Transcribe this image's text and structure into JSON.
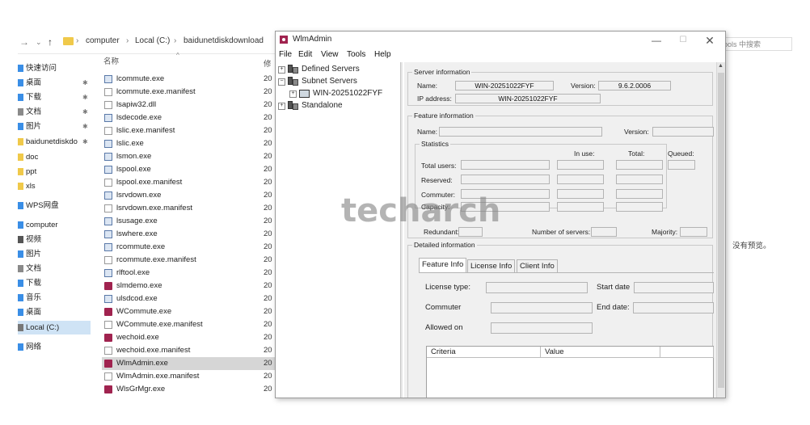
{
  "explorer": {
    "breadcrumb": [
      "computer",
      "Local (C:)",
      "baidunetdiskdownload"
    ],
    "search_placeholder": "ools 中搜索",
    "column_name": "名称",
    "column_date": "修",
    "sidebar": [
      {
        "label": "快速访问",
        "icon": "star-icon",
        "pinned": false
      },
      {
        "label": "桌面",
        "icon": "desktop-icon",
        "pinned": true
      },
      {
        "label": "下载",
        "icon": "download-icon",
        "pinned": true
      },
      {
        "label": "文档",
        "icon": "document-icon",
        "pinned": true
      },
      {
        "label": "图片",
        "icon": "picture-icon",
        "pinned": true
      },
      {
        "label": "baidunetdiskdo",
        "icon": "folder-icon",
        "pinned": true
      },
      {
        "label": "doc",
        "icon": "folder-icon",
        "pinned": false
      },
      {
        "label": "ppt",
        "icon": "folder-icon",
        "pinned": false
      },
      {
        "label": "xls",
        "icon": "folder-icon",
        "pinned": false
      },
      {
        "label": "WPS网盘",
        "icon": "cloud-icon",
        "pinned": false
      },
      {
        "label": "computer",
        "icon": "computer-icon",
        "pinned": false
      },
      {
        "label": "视频",
        "icon": "video-icon",
        "pinned": false
      },
      {
        "label": "图片",
        "icon": "picture-icon",
        "pinned": false
      },
      {
        "label": "文档",
        "icon": "document-icon",
        "pinned": false
      },
      {
        "label": "下载",
        "icon": "download-icon",
        "pinned": false
      },
      {
        "label": "音乐",
        "icon": "music-icon",
        "pinned": false
      },
      {
        "label": "桌面",
        "icon": "desktop-icon",
        "pinned": false
      },
      {
        "label": "Local (C:)",
        "icon": "drive-icon",
        "pinned": false
      },
      {
        "label": "网络",
        "icon": "network-icon",
        "pinned": false
      }
    ],
    "files": [
      {
        "name": "lcommute.exe",
        "type": "exe",
        "date": "20"
      },
      {
        "name": "lcommute.exe.manifest",
        "type": "doc",
        "date": "20"
      },
      {
        "name": "lsapiw32.dll",
        "type": "doc",
        "date": "20"
      },
      {
        "name": "lsdecode.exe",
        "type": "exe",
        "date": "20"
      },
      {
        "name": "lslic.exe.manifest",
        "type": "doc",
        "date": "20"
      },
      {
        "name": "lslic.exe",
        "type": "exe",
        "date": "20"
      },
      {
        "name": "lsmon.exe",
        "type": "exe",
        "date": "20"
      },
      {
        "name": "lspool.exe",
        "type": "exe",
        "date": "20"
      },
      {
        "name": "lspool.exe.manifest",
        "type": "doc",
        "date": "20"
      },
      {
        "name": "lsrvdown.exe",
        "type": "exe",
        "date": "20"
      },
      {
        "name": "lsrvdown.exe.manifest",
        "type": "doc",
        "date": "20"
      },
      {
        "name": "lsusage.exe",
        "type": "exe",
        "date": "20"
      },
      {
        "name": "lswhere.exe",
        "type": "exe",
        "date": "20"
      },
      {
        "name": "rcommute.exe",
        "type": "exe",
        "date": "20"
      },
      {
        "name": "rcommute.exe.manifest",
        "type": "doc",
        "date": "20"
      },
      {
        "name": "rlftool.exe",
        "type": "exe",
        "date": "20"
      },
      {
        "name": "slmdemo.exe",
        "type": "app",
        "date": "20"
      },
      {
        "name": "ulsdcod.exe",
        "type": "exe",
        "date": "20"
      },
      {
        "name": "WCommute.exe",
        "type": "app",
        "date": "20"
      },
      {
        "name": "WCommute.exe.manifest",
        "type": "doc",
        "date": "20"
      },
      {
        "name": "wechoid.exe",
        "type": "app",
        "date": "20"
      },
      {
        "name": "wechoid.exe.manifest",
        "type": "doc",
        "date": "20"
      },
      {
        "name": "WlmAdmin.exe",
        "type": "app",
        "date": "20",
        "selected": true
      },
      {
        "name": "WlmAdmin.exe.manifest",
        "type": "doc",
        "date": "20"
      },
      {
        "name": "WlsGrMgr.exe",
        "type": "app",
        "date": "20"
      }
    ],
    "preview_text": "没有预览。"
  },
  "wlm": {
    "title": "WlmAdmin",
    "menu": [
      "File",
      "Edit",
      "View",
      "Tools",
      "Help"
    ],
    "tree": {
      "defined": "Defined Servers",
      "subnet": "Subnet Servers",
      "server": "WIN-20251022FYF",
      "standalone": "Standalone"
    },
    "server_info": {
      "title": "Server information",
      "name_label": "Name:",
      "name_value": "WIN-20251022FYF",
      "version_label": "Version:",
      "version_value": "9.6.2.0006",
      "ip_label": "IP address:",
      "ip_value": "WIN-20251022FYF"
    },
    "feature_info": {
      "title": "Feature information",
      "name_label": "Name:",
      "version_label": "Version:"
    },
    "statistics": {
      "title": "Statistics",
      "in_use": "In use:",
      "total": "Total:",
      "queued": "Queued:",
      "total_users": "Total users:",
      "reserved": "Reserved:",
      "commuter": "Commuter:",
      "capacity": "Capacity:",
      "redundant": "Redundant:",
      "num_servers": "Number of servers:",
      "majority": "Majority:"
    },
    "detailed": {
      "title": "Detailed information",
      "tabs": [
        "Feature Info",
        "License Info",
        "Client Info"
      ],
      "license_type": "License type:",
      "start_date": "Start date",
      "commuter": "Commuter",
      "end_date": "End date:",
      "allowed_on": "Allowed on",
      "col_criteria": "Criteria",
      "col_value": "Value"
    }
  },
  "watermark": "techarch"
}
